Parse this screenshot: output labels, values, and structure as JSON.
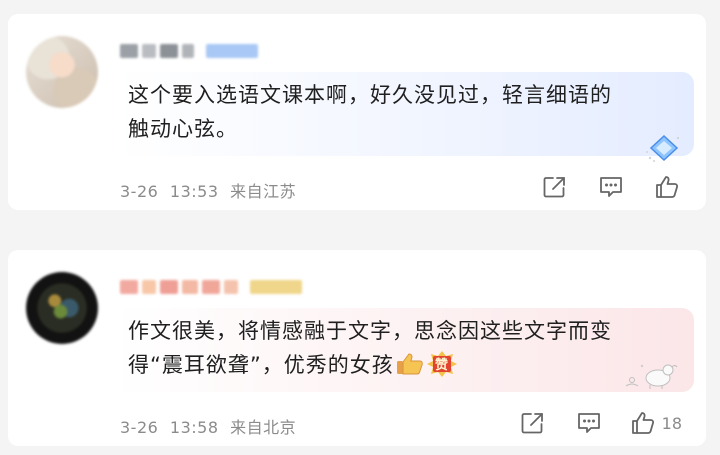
{
  "comments": [
    {
      "text_line1": "这个要入选语文课本啊，好久没见过，轻言细语的",
      "text_line2": "触动心弦。",
      "date": "3-26",
      "time": "13:53",
      "location": "来自江苏",
      "like_count": ""
    },
    {
      "text_line1": "作文很美，将情感融于文字，思念因这些文字而变",
      "text_line2": "得“震耳欲聋”，优秀的女孩",
      "date": "3-26",
      "time": "13:58",
      "location": "来自北京",
      "like_count": "18"
    }
  ],
  "emoji": {
    "zan_text": "赞"
  },
  "icons": {
    "share": "share-icon",
    "reply": "comment-icon",
    "like": "thumbs-up-icon"
  },
  "colors": {
    "background": "#f4f4f5",
    "card": "#ffffff",
    "meta_text": "#8b8b8b",
    "bubble_blue": "#e4ecff",
    "bubble_pink": "#fbe6e8"
  }
}
